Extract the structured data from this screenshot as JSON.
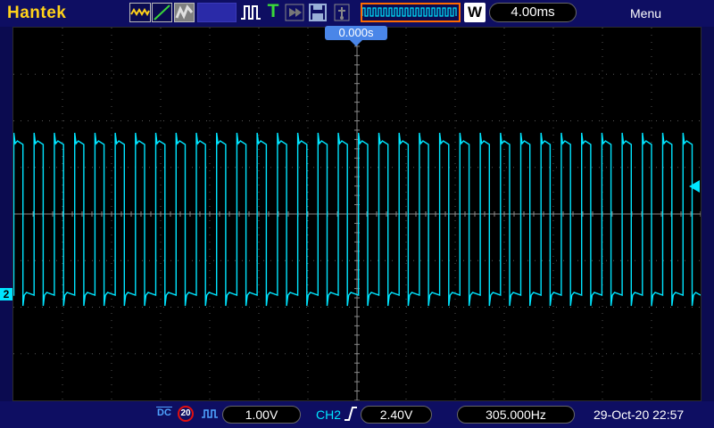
{
  "app": {
    "brand": "Hantek",
    "menu_label": "Menu"
  },
  "toolbar": {
    "trigger_type_label": "T",
    "mode_label": "W",
    "timebase": "4.00ms",
    "icons": [
      "waveform-icon",
      "line-icon",
      "persist-icon",
      "blank-panel",
      "pulse-icon",
      "trigger-icon",
      "arrow-icon",
      "save-icon",
      "usb-icon",
      "wave-overview-icon",
      "mode-icon"
    ]
  },
  "screen": {
    "trigger_time": "0.000s",
    "channel_marker": "2",
    "trace_color": "#00e5ff",
    "grid_color": "#555555",
    "horizontal_divisions": 14,
    "vertical_divisions": 8
  },
  "status": {
    "coupling": "DC",
    "bandwidth_limit": "20",
    "volts_per_div": "1.00V",
    "trigger_source": "CH2",
    "trigger_level": "2.40V",
    "frequency": "305.000Hz",
    "datetime": "29-Oct-20 22:57"
  }
}
